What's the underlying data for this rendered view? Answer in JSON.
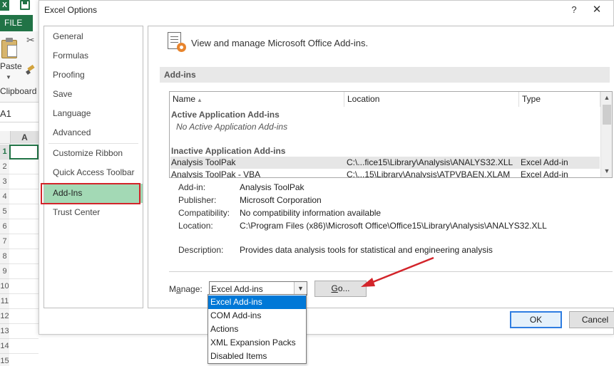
{
  "background_app": {
    "file_tab": "FILE",
    "paste_label": "Paste",
    "clipboard_label": "Clipboard",
    "name_box": "A1",
    "column_header": "A",
    "row_numbers": [
      "1",
      "2",
      "3",
      "4",
      "5",
      "6",
      "7",
      "8",
      "9",
      "10",
      "11",
      "12",
      "13",
      "14",
      "15"
    ]
  },
  "dialog": {
    "title": "Excel Options",
    "help": "?",
    "close": "✕"
  },
  "nav": {
    "items": [
      "General",
      "Formulas",
      "Proofing",
      "Save",
      "Language",
      "Advanced",
      "Customize Ribbon",
      "Quick Access Toolbar",
      "Add-Ins",
      "Trust Center"
    ],
    "selected": "Add-Ins"
  },
  "content": {
    "header": "View and manage Microsoft Office Add-ins.",
    "section": "Add-ins",
    "columns": {
      "name": "Name",
      "location": "Location",
      "type": "Type"
    },
    "active_group": "Active Application Add-ins",
    "active_empty": "No Active Application Add-ins",
    "inactive_group": "Inactive Application Add-ins",
    "rows": [
      {
        "name": "Analysis ToolPak",
        "location": "C:\\...fice15\\Library\\Analysis\\ANALYS32.XLL",
        "type": "Excel Add-in"
      },
      {
        "name": "Analysis ToolPak - VBA",
        "location": "C:\\...15\\Library\\Analysis\\ATPVBAEN.XLAM",
        "type": "Excel Add-in"
      }
    ],
    "details": {
      "addin_label": "Add-in:",
      "addin": "Analysis ToolPak",
      "publisher_label": "Publisher:",
      "publisher": "Microsoft Corporation",
      "compat_label": "Compatibility:",
      "compat": "No compatibility information available",
      "location_label": "Location:",
      "location": "C:\\Program Files (x86)\\Microsoft Office\\Office15\\Library\\Analysis\\ANALYS32.XLL",
      "desc_label": "Description:",
      "desc": "Provides data analysis tools for statistical and engineering analysis"
    },
    "manage_label_pre": "M",
    "manage_label_u": "a",
    "manage_label_post": "nage:",
    "manage_value": "Excel Add-ins",
    "go_pre": "",
    "go_u": "G",
    "go_post": "o...",
    "dropdown_options": [
      "Excel Add-ins",
      "COM Add-ins",
      "Actions",
      "XML Expansion Packs",
      "Disabled Items"
    ]
  },
  "footer": {
    "ok": "OK",
    "cancel": "Cancel"
  },
  "colors": {
    "excel_green": "#217346",
    "nav_selected": "#a3d9b5",
    "annotation_red": "#d3242a",
    "selection_blue": "#0078d7"
  }
}
